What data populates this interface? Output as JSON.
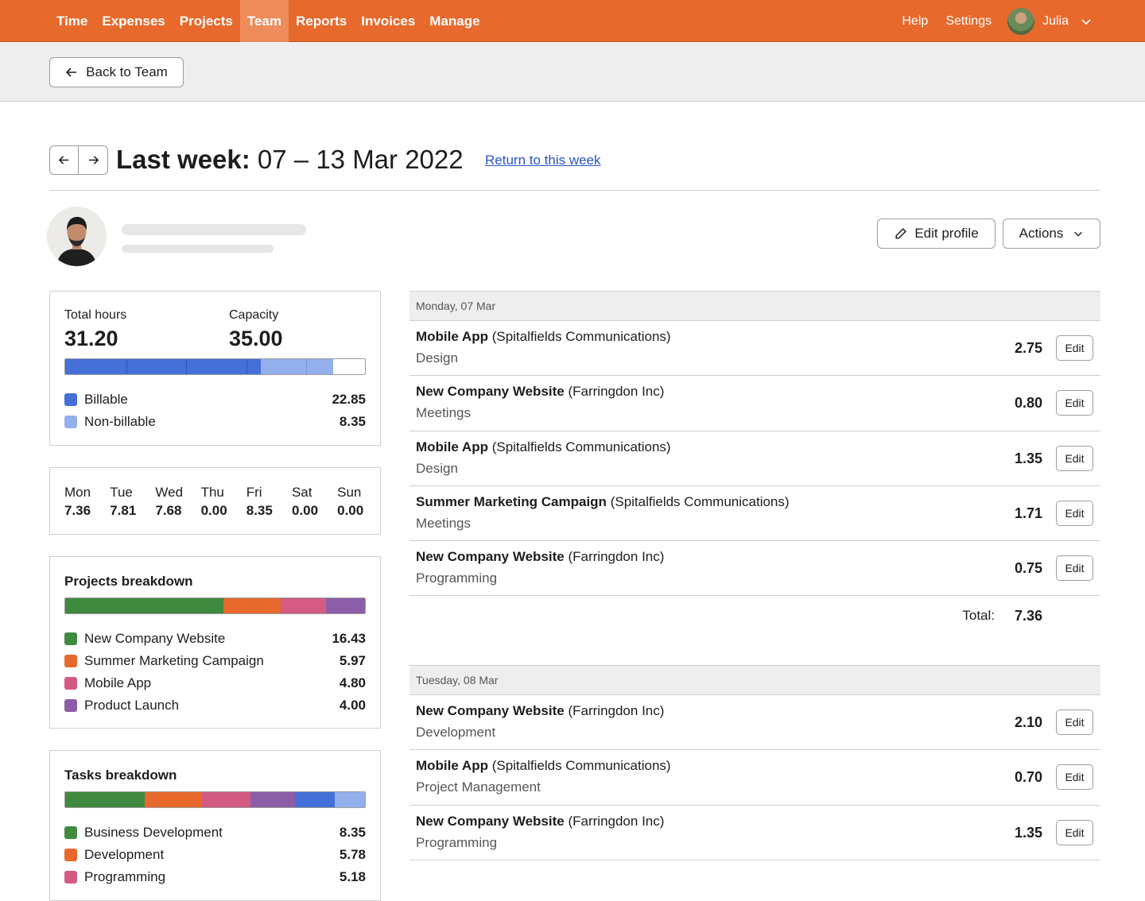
{
  "nav": {
    "items": [
      "Time",
      "Expenses",
      "Projects",
      "Team",
      "Reports",
      "Invoices",
      "Manage"
    ],
    "active": "Team",
    "help": "Help",
    "settings": "Settings",
    "user": "Julia"
  },
  "back_label": "Back to Team",
  "week": {
    "prefix": "Last week:",
    "range": "07 – 13 Mar 2022",
    "return_link": "Return to this week"
  },
  "profile": {
    "edit_label": "Edit profile",
    "actions_label": "Actions"
  },
  "summary": {
    "total_label": "Total hours",
    "total_value": "31.20",
    "capacity_label": "Capacity",
    "capacity_value": "35.00",
    "billable_label": "Billable",
    "billable_value": "22.85",
    "nonbillable_label": "Non-billable",
    "nonbillable_value": "8.35",
    "colors": {
      "billable": "#4470d8",
      "nonbillable": "#93b0ec"
    }
  },
  "days": [
    {
      "d": "Mon",
      "h": "7.36"
    },
    {
      "d": "Tue",
      "h": "7.81"
    },
    {
      "d": "Wed",
      "h": "7.68"
    },
    {
      "d": "Thu",
      "h": "0.00"
    },
    {
      "d": "Fri",
      "h": "8.35"
    },
    {
      "d": "Sat",
      "h": "0.00"
    },
    {
      "d": "Sun",
      "h": "0.00"
    }
  ],
  "projects": {
    "title": "Projects breakdown",
    "items": [
      {
        "name": "New Company Website",
        "value": "16.43",
        "color": "#3f8a3f"
      },
      {
        "name": "Summer Marketing Campaign",
        "value": "5.97",
        "color": "#e8692c"
      },
      {
        "name": "Mobile App",
        "value": "4.80",
        "color": "#d35a82"
      },
      {
        "name": "Product Launch",
        "value": "4.00",
        "color": "#8d5ea8"
      }
    ]
  },
  "tasks": {
    "title": "Tasks breakdown",
    "items": [
      {
        "name": "Business Development",
        "value": "8.35",
        "color": "#3f8a3f"
      },
      {
        "name": "Development",
        "value": "5.78",
        "color": "#e8692c"
      },
      {
        "name": "Programming",
        "value": "5.18",
        "color": "#d35a82"
      }
    ],
    "extra_bar_colors": [
      "#8d5ea8",
      "#4470d8",
      "#93b0ec"
    ]
  },
  "day_groups": [
    {
      "heading": "Monday, 07 Mar",
      "entries": [
        {
          "project": "Mobile App",
          "client": "(Spitalfields Communications)",
          "task": "Design",
          "hours": "2.75"
        },
        {
          "project": "New Company Website",
          "client": "(Farringdon Inc)",
          "task": "Meetings",
          "hours": "0.80"
        },
        {
          "project": "Mobile App",
          "client": "(Spitalfields Communications)",
          "task": "Design",
          "hours": "1.35"
        },
        {
          "project": "Summer Marketing Campaign",
          "client": "(Spitalfields Communications)",
          "task": "Meetings",
          "hours": "1.71"
        },
        {
          "project": "New Company Website",
          "client": "(Farringdon Inc)",
          "task": "Programming",
          "hours": "0.75"
        }
      ],
      "total_label": "Total:",
      "total": "7.36"
    },
    {
      "heading": "Tuesday, 08 Mar",
      "entries": [
        {
          "project": "New Company Website",
          "client": "(Farringdon Inc)",
          "task": "Development",
          "hours": "2.10"
        },
        {
          "project": "Mobile App",
          "client": "(Spitalfields Communications)",
          "task": "Project Management",
          "hours": "0.70"
        },
        {
          "project": "New Company Website",
          "client": "(Farringdon Inc)",
          "task": "Programming",
          "hours": "1.35"
        }
      ]
    }
  ],
  "edit_label": "Edit"
}
